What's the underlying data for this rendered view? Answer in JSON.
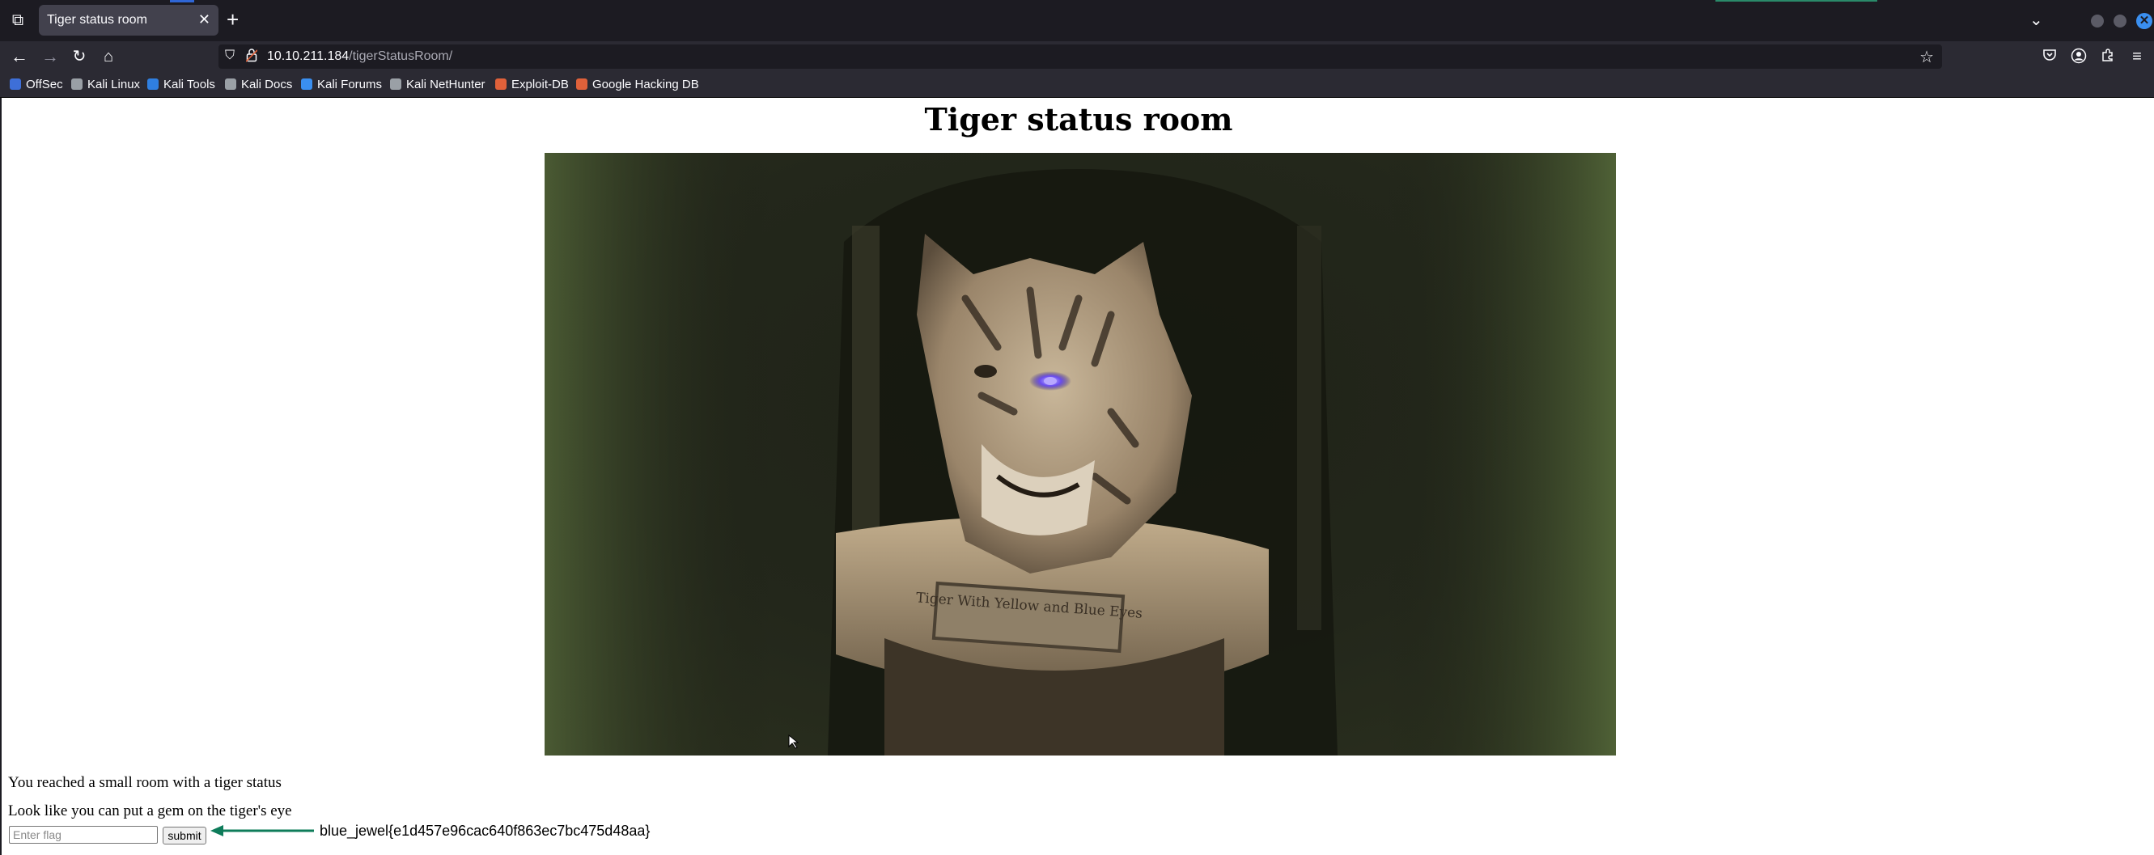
{
  "browser": {
    "tab": {
      "title": "Tiger status room"
    },
    "url": {
      "host": "10.10.211.184",
      "path": "/tigerStatusRoom/"
    },
    "bookmarks": [
      {
        "label": "OffSec",
        "icon": "offsec-icon",
        "color": "#3e6fd8"
      },
      {
        "label": "Kali Linux",
        "icon": "kali-icon",
        "color": "#9aa0a6"
      },
      {
        "label": "Kali Tools",
        "icon": "kali-tools-icon",
        "color": "#2f7fe0"
      },
      {
        "label": "Kali Docs",
        "icon": "kali-icon",
        "color": "#9aa0a6"
      },
      {
        "label": "Kali Forums",
        "icon": "kali-forums-icon",
        "color": "#3a8ff0"
      },
      {
        "label": "Kali NetHunter",
        "icon": "kali-icon",
        "color": "#9aa0a6"
      },
      {
        "label": "Exploit-DB",
        "icon": "exploitdb-icon",
        "color": "#e0613a"
      },
      {
        "label": "Google Hacking DB",
        "icon": "ghdb-icon",
        "color": "#e0613a"
      }
    ]
  },
  "page": {
    "title": "Tiger status room",
    "image": {
      "alt": "tiger-statue-image",
      "plaque_text": "Tiger With Yellow and Blue Eyes"
    },
    "paragraphs": [
      "You reached a small room with a tiger status",
      "Look like you can put a gem on the tiger's eye"
    ],
    "form": {
      "input_placeholder": "Enter flag",
      "input_value": "",
      "submit_label": "submit"
    },
    "annotation": {
      "text": "blue_jewel{e1d457e96cac640f863ec7bc475d48aa}",
      "arrow_color": "#0e7c5a"
    }
  }
}
